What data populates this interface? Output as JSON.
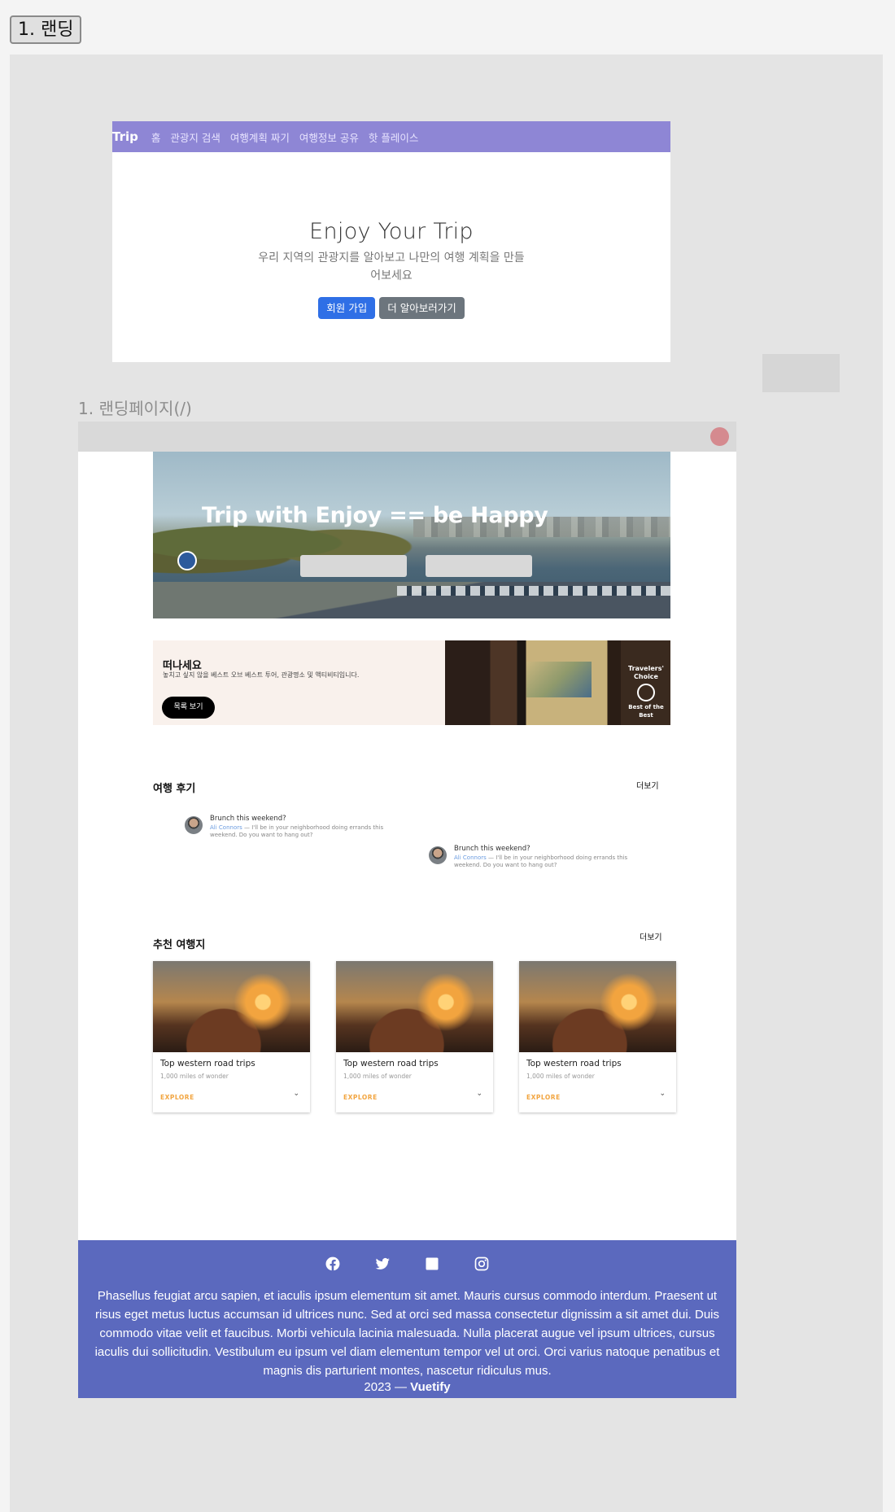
{
  "page_tab": "1. 랜딩",
  "mockup1": {
    "brand": "Trip",
    "nav": [
      "홈",
      "관광지 검색",
      "여행계획 짜기",
      "여행정보 공유",
      "핫 플레이스"
    ],
    "hero_title": "Enjoy Your Trip",
    "hero_subtitle": "우리 지역의 관광지를 알아보고 나만의 여행 계획을 만들어보세요",
    "primary_button": "회원 가입",
    "secondary_button": "더 알아보러가기"
  },
  "section_label": "1. 랜딩페이지(/)",
  "mockup2": {
    "hero_title": "Trip with Enjoy == be Happy",
    "promo": {
      "title": "떠나세요",
      "text": "놓치고 싶지 않을 베스트 오브 베스트 투어, 관광명소 및 액티비티입니다.",
      "button": "목록 보기",
      "badge_line1": "Travelers'",
      "badge_line2": "Choice",
      "badge_line3": "Best of the Best"
    },
    "reviews_section": {
      "title": "여행 후기",
      "more": "더보기",
      "items": [
        {
          "heading": "Brunch this weekend?",
          "author": "Ali Connors",
          "text": " — I'll be in your neighborhood doing errands this weekend. Do you want to hang out?"
        },
        {
          "heading": "Brunch this weekend?",
          "author": "Ali Connors",
          "text": " — I'll be in your neighborhood doing errands this weekend. Do you want to hang out?"
        }
      ]
    },
    "recommend_section": {
      "title": "추천 여행지",
      "more": "더보기",
      "cards": [
        {
          "title": "Top western road trips",
          "subtitle": "1,000 miles of wonder",
          "action": "EXPLORE"
        },
        {
          "title": "Top western road trips",
          "subtitle": "1,000 miles of wonder",
          "action": "EXPLORE"
        },
        {
          "title": "Top western road trips",
          "subtitle": "1,000 miles of wonder",
          "action": "EXPLORE"
        }
      ]
    },
    "footer": {
      "text": "Phasellus feugiat arcu sapien, et iaculis ipsum elementum sit amet. Mauris cursus commodo interdum. Praesent ut risus eget metus luctus accumsan id ultrices nunc. Sed at orci sed massa consectetur dignissim a sit amet dui. Duis commodo vitae velit et faucibus. Morbi vehicula lacinia malesuada. Nulla placerat augue vel ipsum ultrices, cursus iaculis dui sollicitudin. Vestibulum eu ipsum vel diam elementum tempor vel ut orci. Orci varius natoque penatibus et magnis dis parturient montes, nascetur ridiculus mus.",
      "year": "2023 — ",
      "brand": "Vuetify",
      "icons": [
        "facebook-icon",
        "twitter-icon",
        "linkedin-icon",
        "instagram-icon"
      ]
    }
  },
  "colors": {
    "navbar": "#8e86d5",
    "primary": "#2f6fe6",
    "secondary": "#6c757d",
    "footer": "#5b69be",
    "explore": "#f2a540"
  }
}
